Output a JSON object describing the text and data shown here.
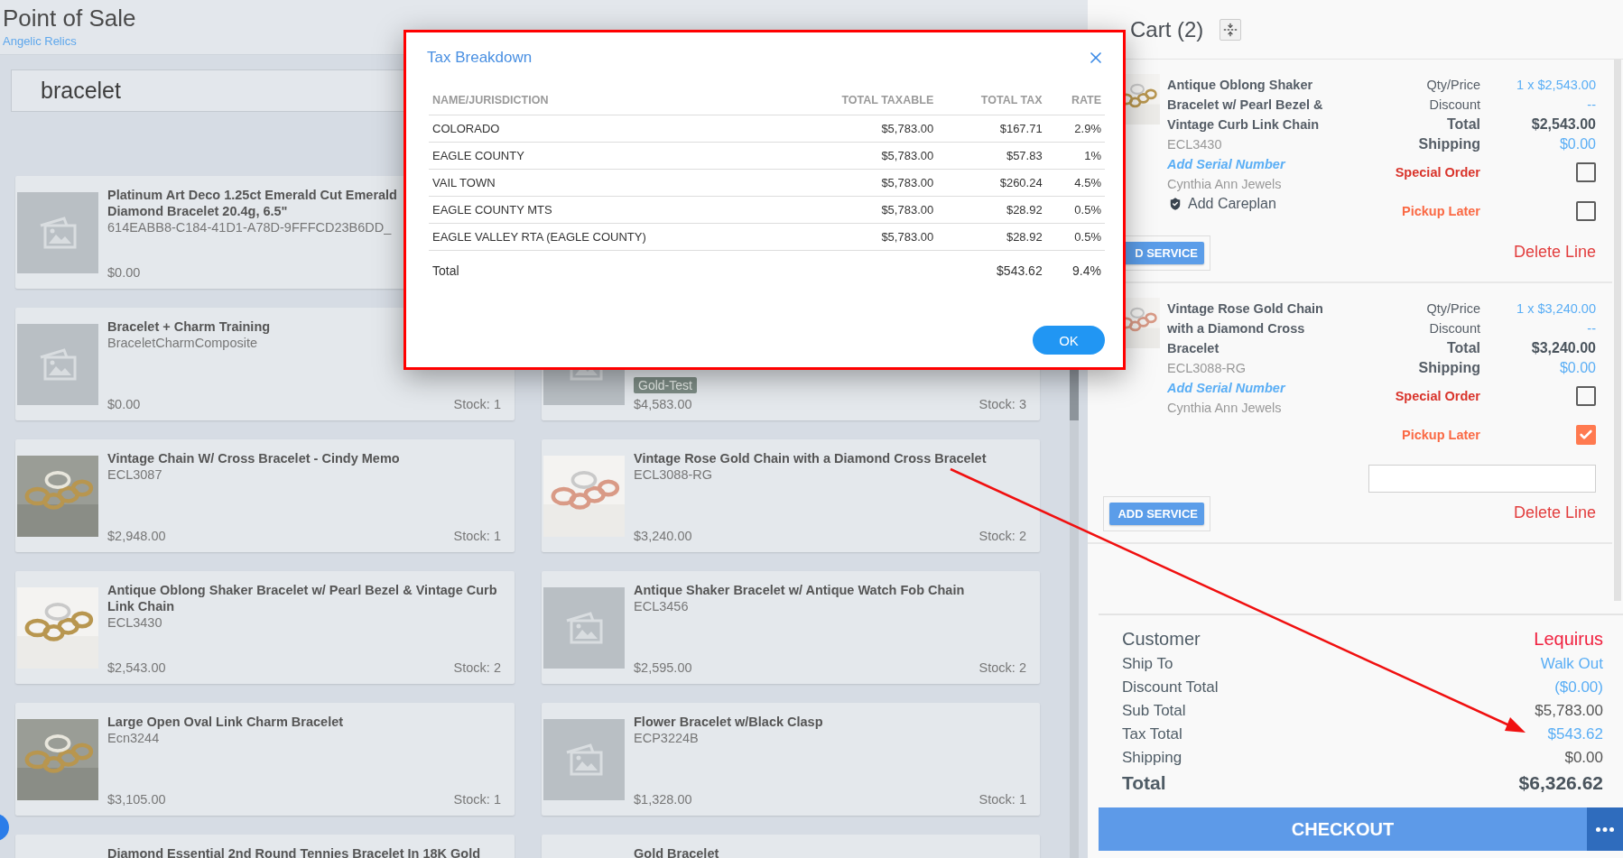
{
  "header": {
    "title": "Point of Sale",
    "store": "Angelic Relics"
  },
  "search": {
    "value": "bracelet"
  },
  "products": [
    {
      "title": "Platinum Art Deco 1.25ct Emerald Cut Emerald\nDiamond Bracelet 20.4g, 6.5\"",
      "sku": "614EABB8-C184-41D1-A78D-9FFFCD23B6DD_",
      "price": "$0.00",
      "kind": "placeholder"
    },
    {
      "kind": "blank"
    },
    {
      "title": "Bracelet + Charm Training",
      "sku": "BraceletCharmComposite",
      "price": "$0.00",
      "stock": "Stock: 1",
      "kind": "placeholder"
    },
    {
      "tag": "Gold-Test",
      "price": "$4,583.00",
      "stock": "Stock: 3",
      "kind": "placeholder"
    },
    {
      "title": "Vintage Chain W/ Cross Bracelet - Cindy Memo",
      "sku": "ECL3087",
      "price": "$2,948.00",
      "stock": "Stock: 1"
    },
    {
      "title": "Vintage Rose Gold Chain with a Diamond Cross Bracelet",
      "sku": "ECL3088-RG",
      "price": "$3,240.00",
      "stock": "Stock: 2"
    },
    {
      "title": "Antique Oblong Shaker Bracelet w/ Pearl Bezel & Vintage Curb Link Chain",
      "sku": "ECL3430",
      "price": "$2,543.00",
      "stock": "Stock: 2"
    },
    {
      "title": "Antique Shaker Bracelet w/ Antique Watch Fob Chain",
      "sku": "ECL3456",
      "price": "$2,595.00",
      "stock": "Stock: 2",
      "kind": "placeholder"
    },
    {
      "title": "Large Open Oval Link Charm Bracelet",
      "sku": "Ecn3244",
      "price": "$3,105.00",
      "stock": "Stock: 1"
    },
    {
      "title": "Flower Bracelet w/Black Clasp",
      "sku": "ECP3224B",
      "price": "$1,328.00",
      "stock": "Stock: 1",
      "kind": "placeholder"
    },
    {
      "title": "Diamond Essential 2nd Round Tennies Bracelet In 18K Gold",
      "kind": "blank"
    },
    {
      "title": "Gold Bracelet",
      "kind": "blank"
    }
  ],
  "dialog": {
    "title": "Tax Breakdown",
    "columns": [
      "NAME/JURISDICTION",
      "TOTAL TAXABLE",
      "TOTAL TAX",
      "RATE"
    ],
    "rows": [
      [
        "COLORADO",
        "$5,783.00",
        "$167.71",
        "2.9%"
      ],
      [
        "EAGLE COUNTY",
        "$5,783.00",
        "$57.83",
        "1%"
      ],
      [
        "VAIL TOWN",
        "$5,783.00",
        "$260.24",
        "4.5%"
      ],
      [
        "EAGLE COUNTY MTS",
        "$5,783.00",
        "$28.92",
        "0.5%"
      ],
      [
        "EAGLE VALLEY RTA (EAGLE COUNTY)",
        "$5,783.00",
        "$28.92",
        "0.5%"
      ]
    ],
    "total": {
      "label": "Total",
      "tax": "$543.62",
      "rate": "9.4%"
    },
    "ok": "OK"
  },
  "cart": {
    "title": "Cart (2)",
    "items": [
      {
        "title": "Antique Oblong Shaker Bracelet w/ Pearl Bezel & Vintage Curb Link Chain",
        "sku": "ECL3430",
        "serial_link": "Add Serial Number",
        "vendor": "Cynthia Ann Jewels",
        "careplan": "Add Careplan",
        "details": [
          {
            "label": "Qty/Price",
            "value": "1 x $2,543.00",
            "kind": "link"
          },
          {
            "label": "Discount",
            "value": "--",
            "kind": "link"
          },
          {
            "label": "Total",
            "value": "$2,543.00",
            "kind": "total"
          },
          {
            "label": "Shipping",
            "value": "$0.00",
            "kind": "shipping"
          }
        ],
        "special_order": {
          "label": "Special Order",
          "checked": false
        },
        "pickup_later": {
          "label": "Pickup Later",
          "checked": false
        },
        "add_service": "D SERVICE",
        "delete": "Delete Line"
      },
      {
        "title": "Vintage Rose Gold Chain with a Diamond Cross Bracelet",
        "sku": "ECL3088-RG",
        "serial_link": "Add Serial Number",
        "vendor": "Cynthia Ann Jewels",
        "details": [
          {
            "label": "Qty/Price",
            "value": "1 x $3,240.00",
            "kind": "link"
          },
          {
            "label": "Discount",
            "value": "--",
            "kind": "link"
          },
          {
            "label": "Total",
            "value": "$3,240.00",
            "kind": "total"
          },
          {
            "label": "Shipping",
            "value": "$0.00",
            "kind": "shipping"
          }
        ],
        "special_order": {
          "label": "Special Order",
          "checked": false
        },
        "pickup_later": {
          "label": "Pickup Later",
          "checked": true
        },
        "add_service": "ADD SERVICE",
        "delete": "Delete Line"
      }
    ],
    "summary": [
      {
        "label": "Customer",
        "value": "Lequirus",
        "kind": "customer"
      },
      {
        "label": "Ship To",
        "value": "Walk Out",
        "kind": "link"
      },
      {
        "label": "Discount Total",
        "value": "($0.00)",
        "kind": "link"
      },
      {
        "label": "Sub Total",
        "value": "$5,783.00",
        "kind": "plain"
      },
      {
        "label": "Tax Total",
        "value": "$543.62",
        "kind": "link"
      },
      {
        "label": "Shipping",
        "value": "$0.00",
        "kind": "plain"
      },
      {
        "label": "Total",
        "value": "$6,326.62",
        "kind": "total"
      }
    ],
    "checkout": "CHECKOUT"
  }
}
